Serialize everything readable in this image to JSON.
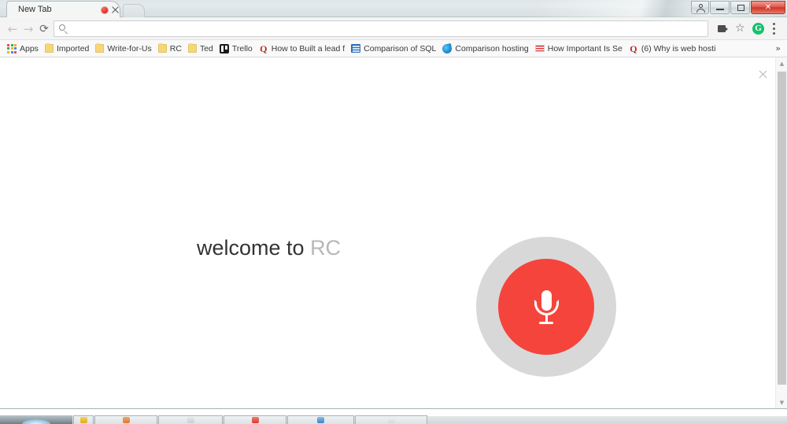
{
  "window": {
    "controls": [
      {
        "name": "user-account-button",
        "glyph": ""
      },
      {
        "name": "minimize-button",
        "glyph": ""
      },
      {
        "name": "maximize-button",
        "glyph": ""
      },
      {
        "name": "close-button",
        "glyph": "✕"
      }
    ]
  },
  "tab": {
    "title": "New Tab",
    "record_indicator": "recording-dot",
    "close_label": "×",
    "new_tab_label": "+"
  },
  "toolbar": {
    "back_glyph": "←",
    "forward_glyph": "→",
    "reload_glyph": "⟳",
    "omnibox_value": "",
    "omnibox_placeholder": "",
    "search_icon": "search-icon",
    "cast_icon": "cast-icon",
    "star_glyph": "☆",
    "extension_label": "G",
    "menu_icon": "three-dot-menu-icon"
  },
  "bookmarks": {
    "overflow_glyph": "»",
    "items": [
      {
        "label": "Apps",
        "icon": "apps-grid-icon"
      },
      {
        "label": "Imported",
        "icon": "folder-icon"
      },
      {
        "label": "Write-for-Us",
        "icon": "folder-icon"
      },
      {
        "label": "RC",
        "icon": "folder-icon"
      },
      {
        "label": "Ted",
        "icon": "folder-icon"
      },
      {
        "label": "Trello",
        "icon": "trello-icon"
      },
      {
        "label": "How to Built a lead f",
        "icon": "quora-icon"
      },
      {
        "label": "Comparison of SQL",
        "icon": "table-icon"
      },
      {
        "label": "Comparison hosting",
        "icon": "droplet-icon"
      },
      {
        "label": "How Important Is Se",
        "icon": "stripes-icon"
      },
      {
        "label": "(6) Why is web hosti",
        "icon": "quora-icon"
      }
    ]
  },
  "page": {
    "close_glyph": "×",
    "welcome_prefix": "welcome to ",
    "app_name": "RC",
    "mic_button_name": "microphone-record-button",
    "scrollbar": {
      "up_glyph": "▲",
      "down_glyph": "▼"
    }
  },
  "colors": {
    "mic_red": "#f5443c",
    "mic_ring_gray": "#d8d8d8",
    "app_name_gray": "#b7b7b7",
    "extension_green": "#15c26b",
    "quora_red": "#b92b27"
  }
}
